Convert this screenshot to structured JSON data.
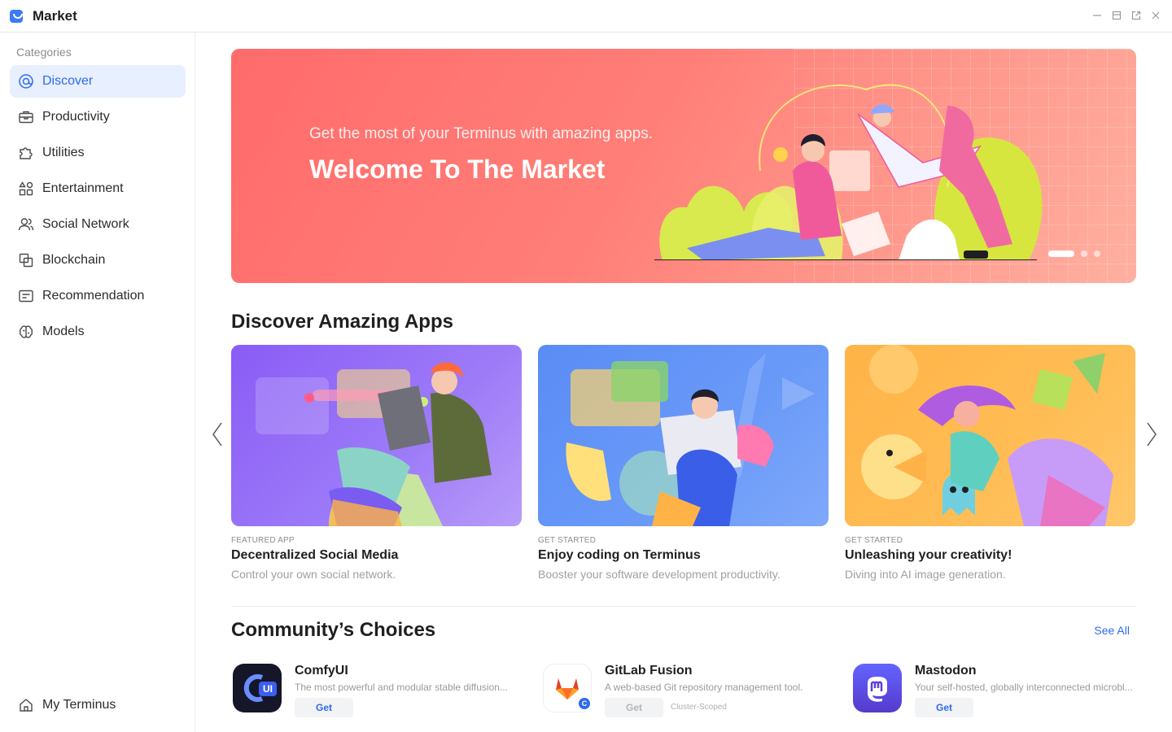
{
  "window": {
    "title": "Market",
    "controls": [
      "minimize-icon",
      "maximize-icon",
      "popout-icon",
      "close-icon"
    ]
  },
  "sidebar": {
    "heading": "Categories",
    "items": [
      {
        "label": "Discover",
        "icon": "discover-icon",
        "active": true
      },
      {
        "label": "Productivity",
        "icon": "briefcase-icon"
      },
      {
        "label": "Utilities",
        "icon": "puzzle-icon"
      },
      {
        "label": "Entertainment",
        "icon": "shapes-icon"
      },
      {
        "label": "Social Network",
        "icon": "users-icon"
      },
      {
        "label": "Blockchain",
        "icon": "blocks-icon"
      },
      {
        "label": "Recommendation",
        "icon": "list-card-icon"
      },
      {
        "label": "Models",
        "icon": "brain-icon"
      }
    ],
    "footer": {
      "label": "My Terminus",
      "icon": "home-icon"
    }
  },
  "banner": {
    "subtitle": "Get the most of your Terminus with amazing apps.",
    "title": "Welcome To The Market",
    "slides": 3,
    "active_slide": 1
  },
  "discover": {
    "title": "Discover Amazing Apps",
    "cards": [
      {
        "tag": "FEATURED APP",
        "title": "Decentralized Social Media",
        "desc": "Control your own social network."
      },
      {
        "tag": "GET STARTED",
        "title": "Enjoy coding on Terminus",
        "desc": "Booster your software development productivity."
      },
      {
        "tag": "GET STARTED",
        "title": "Unleashing your creativity!",
        "desc": "Diving into AI image generation."
      }
    ]
  },
  "community": {
    "title": "Community’s Choices",
    "see_all": "See All",
    "apps": [
      {
        "name": "ComfyUI",
        "desc": "The most powerful and modular stable diffusion...",
        "button": "Get",
        "enabled": true
      },
      {
        "name": "GitLab Fusion",
        "desc": "A web-based Git repository management tool.",
        "button": "Get",
        "enabled": false,
        "scope": "Cluster-Scoped",
        "badge": "C"
      },
      {
        "name": "Mastodon",
        "desc": "Your self-hosted, globally interconnected microbl...",
        "button": "Get",
        "enabled": true
      }
    ]
  },
  "colors": {
    "accent": "#2d6bf0",
    "banner_start": "#ff6b6b",
    "banner_end": "#ffb0a0",
    "card1": "#8b66f5",
    "card2": "#5b8df5",
    "card3": "#ffb347"
  }
}
